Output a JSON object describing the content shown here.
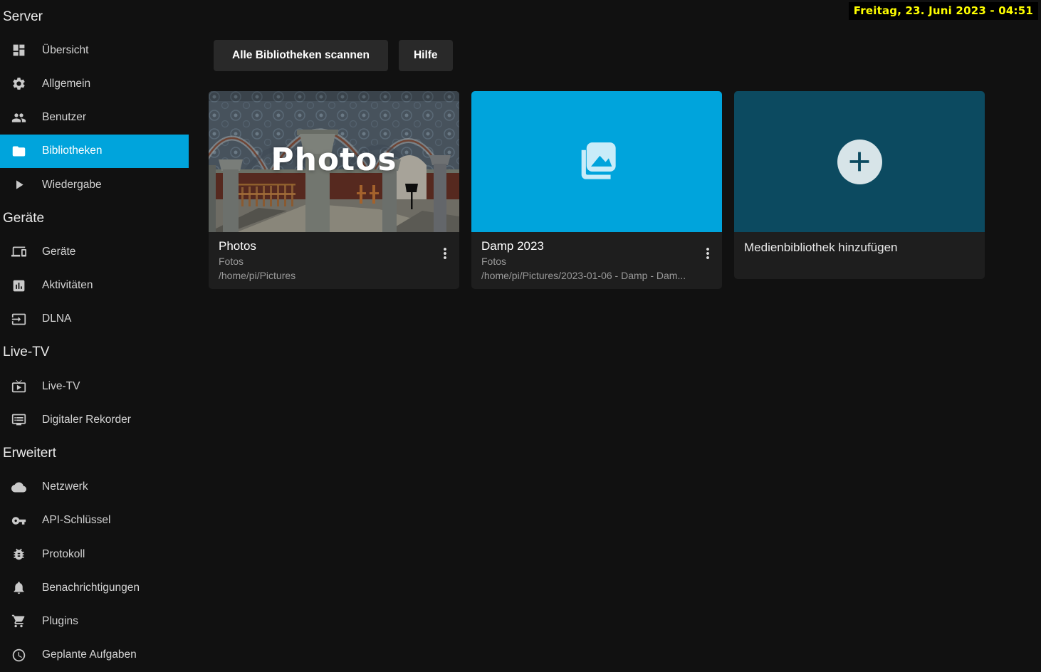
{
  "osd": {
    "datetime": "Freitag, 23. Juni 2023 - 04:51"
  },
  "sidebar": {
    "sections": [
      {
        "header": "Server",
        "items": [
          {
            "label": "Übersicht",
            "icon": "dashboard-icon",
            "selected": false
          },
          {
            "label": "Allgemein",
            "icon": "gear-icon",
            "selected": false
          },
          {
            "label": "Benutzer",
            "icon": "users-icon",
            "selected": false
          },
          {
            "label": "Bibliotheken",
            "icon": "folder-icon",
            "selected": true
          },
          {
            "label": "Wiedergabe",
            "icon": "play-icon",
            "selected": false
          }
        ]
      },
      {
        "header": "Geräte",
        "items": [
          {
            "label": "Geräte",
            "icon": "devices-icon",
            "selected": false
          },
          {
            "label": "Aktivitäten",
            "icon": "bar-chart-icon",
            "selected": false
          },
          {
            "label": "DLNA",
            "icon": "input-icon",
            "selected": false
          }
        ]
      },
      {
        "header": "Live-TV",
        "items": [
          {
            "label": "Live-TV",
            "icon": "live-tv-icon",
            "selected": false
          },
          {
            "label": "Digitaler Rekorder",
            "icon": "dvr-icon",
            "selected": false
          }
        ]
      },
      {
        "header": "Erweitert",
        "items": [
          {
            "label": "Netzwerk",
            "icon": "cloud-icon",
            "selected": false
          },
          {
            "label": "API-Schlüssel",
            "icon": "key-icon",
            "selected": false
          },
          {
            "label": "Protokoll",
            "icon": "bug-icon",
            "selected": false
          },
          {
            "label": "Benachrichtigungen",
            "icon": "bell-icon",
            "selected": false
          },
          {
            "label": "Plugins",
            "icon": "cart-icon",
            "selected": false
          },
          {
            "label": "Geplante Aufgaben",
            "icon": "clock-icon",
            "selected": false
          }
        ]
      }
    ]
  },
  "toolbar": {
    "scan_button": "Alle Bibliotheken scannen",
    "help_button": "Hilfe"
  },
  "libraries": [
    {
      "title": "Photos",
      "subtitle": "Fotos",
      "path": "/home/pi/Pictures",
      "cover_text": "Photos",
      "cover_type": "image",
      "menu_icon": "more-vert-icon"
    },
    {
      "title": "Damp 2023",
      "subtitle": "Fotos",
      "path": "/home/pi/Pictures/2023-01-06 - Damp - Dam...",
      "cover_type": "photo-library-icon",
      "menu_icon": "more-vert-icon"
    },
    {
      "title": "Medienbibliothek hinzufügen",
      "cover_type": "add-icon"
    }
  ],
  "colors": {
    "accent_blue": "#00a4dc",
    "add_card_teal": "#0c4a60",
    "osd_yellow": "#ffff00",
    "card_footer": "#1e1e1e",
    "button_gray": "#292929"
  }
}
